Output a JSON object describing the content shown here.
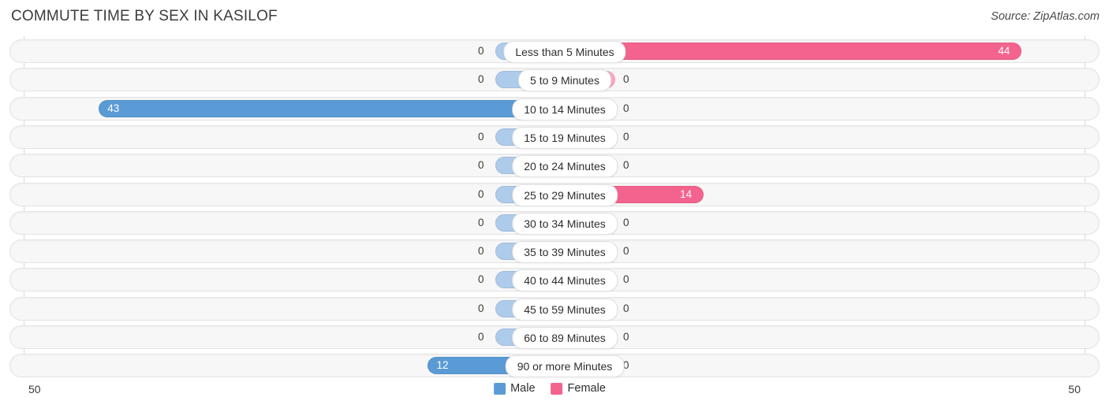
{
  "header": {
    "title": "COMMUTE TIME BY SEX IN KASILOF",
    "source": "Source: ZipAtlas.com"
  },
  "axis": {
    "left_tick": "50",
    "right_tick": "50",
    "max": 50
  },
  "legend": {
    "items": [
      {
        "label": "Male",
        "color": "#5b9bd5"
      },
      {
        "label": "Female",
        "color": "#f4638e"
      }
    ]
  },
  "colors": {
    "male_strong": "#5b9bd5",
    "male_light": "#aecbeb",
    "female_strong": "#f4638e",
    "female_light": "#f9a8c4",
    "track_fill": "#f7f7f7",
    "track_border": "#e3e3e3"
  },
  "chart_data": {
    "type": "bar",
    "orientation": "horizontal",
    "layout": "diverging-bidirectional",
    "title": "COMMUTE TIME BY SEX IN KASILOF",
    "xlabel": "",
    "ylabel": "",
    "xlim": [
      50,
      50
    ],
    "grid": false,
    "legend_position": "bottom-center",
    "categories": [
      "Less than 5 Minutes",
      "5 to 9 Minutes",
      "10 to 14 Minutes",
      "15 to 19 Minutes",
      "20 to 24 Minutes",
      "25 to 29 Minutes",
      "30 to 34 Minutes",
      "35 to 39 Minutes",
      "40 to 44 Minutes",
      "45 to 59 Minutes",
      "60 to 89 Minutes",
      "90 or more Minutes"
    ],
    "series": [
      {
        "name": "Male",
        "direction": "left",
        "values": [
          0,
          0,
          43,
          0,
          0,
          0,
          0,
          0,
          0,
          0,
          0,
          12
        ],
        "labels": [
          "0",
          "0",
          "43",
          "0",
          "0",
          "0",
          "0",
          "0",
          "0",
          "0",
          "0",
          "12"
        ]
      },
      {
        "name": "Female",
        "direction": "right",
        "values": [
          44,
          0,
          0,
          0,
          0,
          14,
          0,
          0,
          0,
          0,
          0,
          0
        ],
        "labels": [
          "44",
          "0",
          "0",
          "0",
          "0",
          "14",
          "0",
          "0",
          "0",
          "0",
          "0",
          "0"
        ]
      }
    ]
  }
}
